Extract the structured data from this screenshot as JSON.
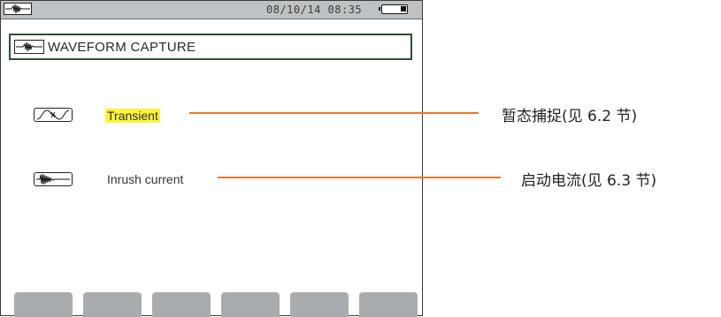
{
  "statusbar": {
    "mode_icon": "waveform-icon",
    "datetime": "08/10/14  08:35",
    "battery_icon": "battery-icon"
  },
  "header": {
    "icon": "waveform-icon",
    "title": "WAVEFORM CAPTURE"
  },
  "menu": {
    "items": [
      {
        "icon": "transient-icon",
        "label": "Transient",
        "selected": true
      },
      {
        "icon": "inrush-icon",
        "label": "Inrush current",
        "selected": false
      }
    ]
  },
  "callouts": [
    {
      "text": "暂态捕捉(见 6.2 节)"
    },
    {
      "text": "启动电流(见 6.3 节)"
    }
  ],
  "softkeys": [
    "",
    "",
    "",
    "",
    "",
    ""
  ],
  "colors": {
    "highlight": "#fdf33a",
    "leader_line": "#e8782f",
    "statusbar_bg": "#bfc2c4",
    "softkey_bg": "#a9acaf",
    "title_border": "#2e4f36"
  }
}
